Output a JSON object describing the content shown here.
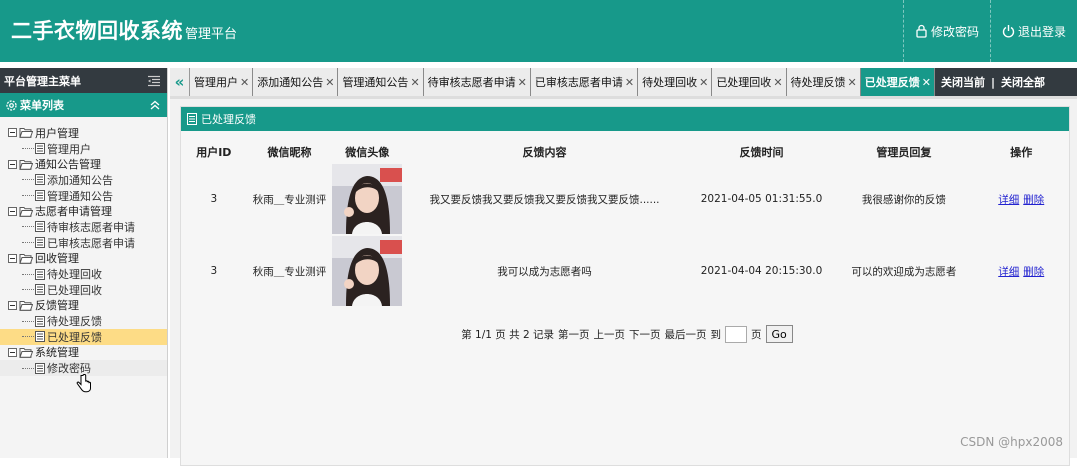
{
  "header": {
    "title": "二手衣物回收系统",
    "subtitle": "管理平台",
    "change_password": "修改密码",
    "logout": "退出登录"
  },
  "sidebar": {
    "title": "平台管理主菜单",
    "menu_list": "菜单列表",
    "groups": [
      {
        "label": "用户管理",
        "items": [
          {
            "label": "管理用户"
          }
        ]
      },
      {
        "label": "通知公告管理",
        "items": [
          {
            "label": "添加通知公告"
          },
          {
            "label": "管理通知公告"
          }
        ]
      },
      {
        "label": "志愿者申请管理",
        "items": [
          {
            "label": "待审核志愿者申请"
          },
          {
            "label": "已审核志愿者申请"
          }
        ]
      },
      {
        "label": "回收管理",
        "items": [
          {
            "label": "待处理回收"
          },
          {
            "label": "已处理回收"
          }
        ]
      },
      {
        "label": "反馈管理",
        "items": [
          {
            "label": "待处理反馈"
          },
          {
            "label": "已处理反馈"
          }
        ]
      },
      {
        "label": "系统管理",
        "items": [
          {
            "label": "修改密码"
          }
        ]
      }
    ]
  },
  "tabs": [
    {
      "label": "管理用户"
    },
    {
      "label": "添加通知公告"
    },
    {
      "label": "管理通知公告"
    },
    {
      "label": "待审核志愿者申请"
    },
    {
      "label": "已审核志愿者申请"
    },
    {
      "label": "待处理回收"
    },
    {
      "label": "已处理回收"
    },
    {
      "label": "待处理反馈"
    },
    {
      "label": "已处理反馈"
    }
  ],
  "tab_close_glyph": "✕",
  "tab_actions": {
    "close_current": "关闭当前",
    "separator": "|",
    "close_all": "关闭全部"
  },
  "panel": {
    "title": "已处理反馈"
  },
  "table": {
    "columns": [
      "用户ID",
      "微信昵称",
      "微信头像",
      "反馈内容",
      "反馈时间",
      "管理员回复",
      "操作"
    ],
    "rows": [
      {
        "user_id": "3",
        "nickname": "秋雨＿专业测评",
        "content": "我又要反馈我又要反馈我又要反馈我又要反馈......",
        "time": "2021-04-05 01:31:55.0",
        "reply": "我很感谢你的反馈",
        "detail": "详细",
        "delete": "删除"
      },
      {
        "user_id": "3",
        "nickname": "秋雨＿专业测评",
        "content": "我可以成为志愿者吗",
        "time": "2021-04-04 20:15:30.0",
        "reply": "可以的欢迎成为志愿者",
        "detail": "详细",
        "delete": "删除"
      }
    ]
  },
  "pager": {
    "info": "第 1/1 页 共 2 记录",
    "first": "第一页",
    "prev": "上一页",
    "next": "下一页",
    "last": "最后一页",
    "goto_label": "到",
    "page_unit": "页",
    "go": "Go",
    "input_value": ""
  },
  "watermark": "CSDN @hpx2008",
  "colors": {
    "accent": "#17998a",
    "dark": "#333a40",
    "active_item": "#fddc86",
    "link": "#2323d0"
  }
}
